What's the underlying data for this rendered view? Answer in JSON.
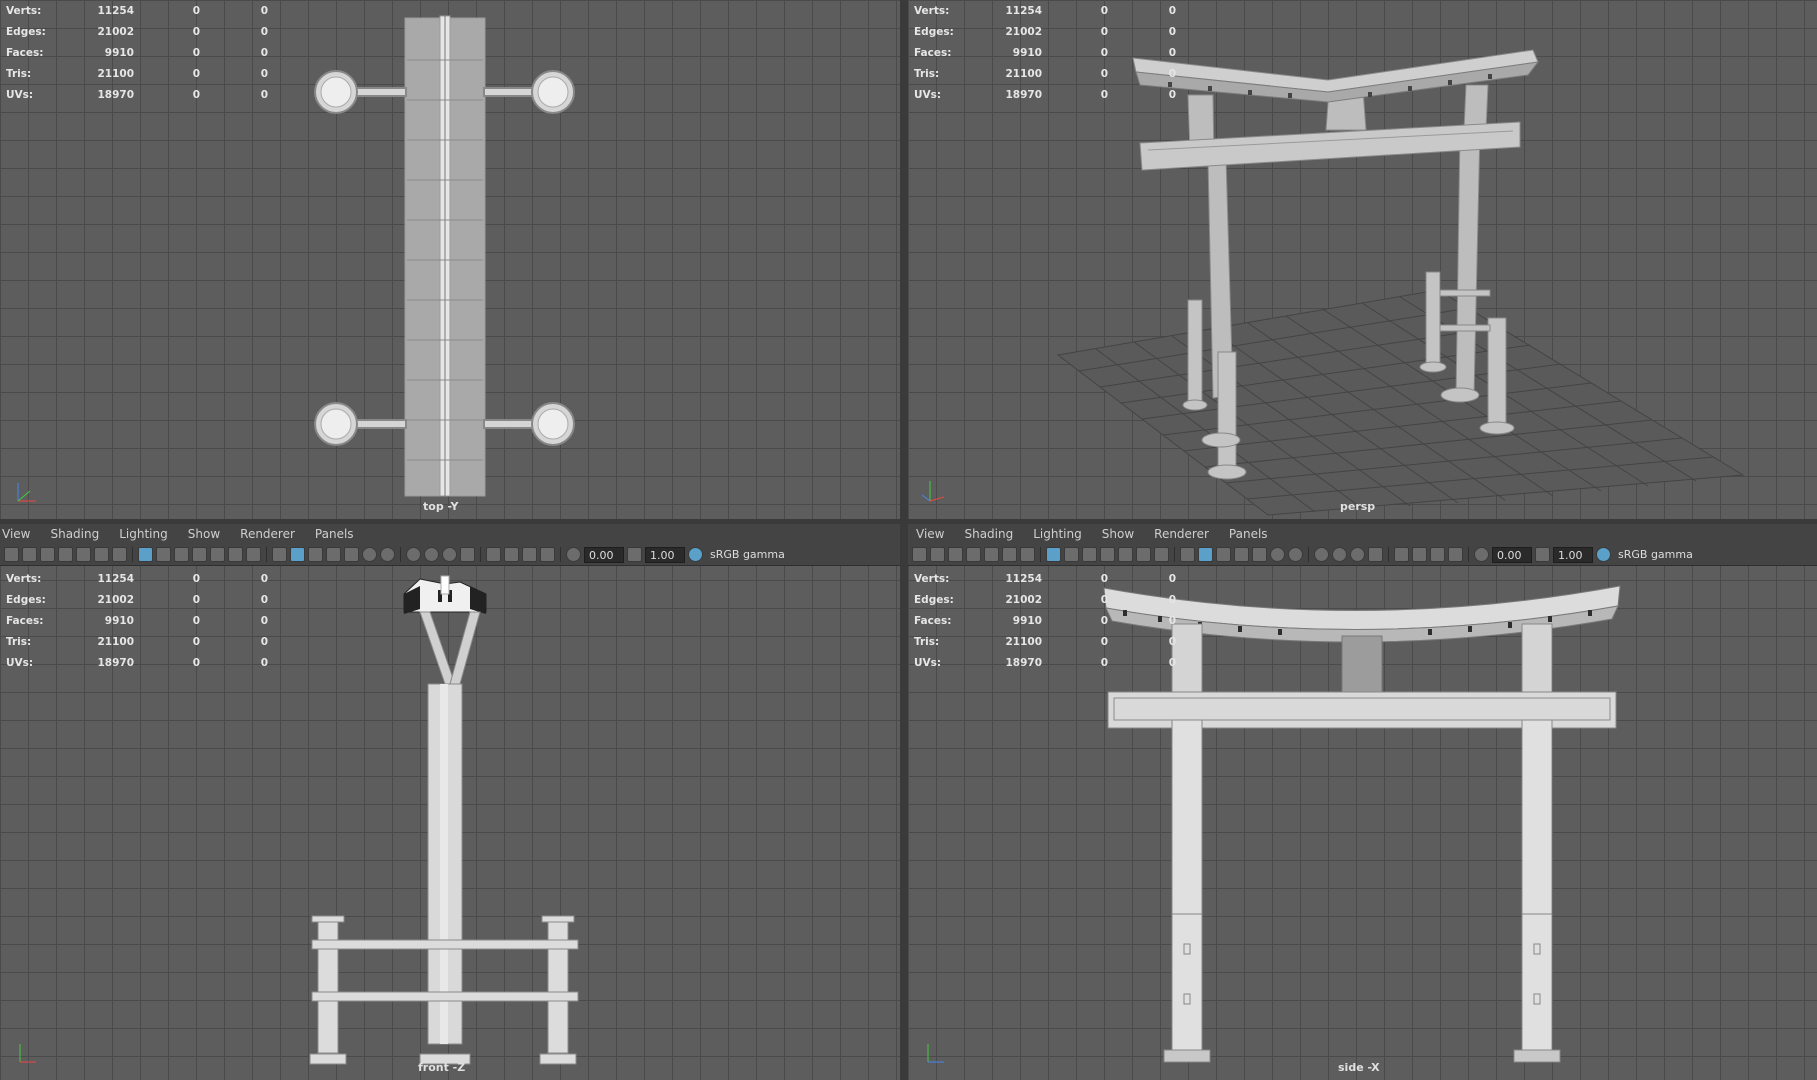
{
  "hud": {
    "rows": [
      {
        "label": "Verts:",
        "v1": "11254",
        "v2": "0",
        "v3": "0"
      },
      {
        "label": "Edges:",
        "v1": "21002",
        "v2": "0",
        "v3": "0"
      },
      {
        "label": "Faces:",
        "v1": "9910",
        "v2": "0",
        "v3": "0"
      },
      {
        "label": "Tris:",
        "v1": "21100",
        "v2": "0",
        "v3": "0"
      },
      {
        "label": "UVs:",
        "v1": "18970",
        "v2": "0",
        "v3": "0"
      }
    ]
  },
  "menu": {
    "view": "View",
    "shading": "Shading",
    "lighting": "Lighting",
    "show": "Show",
    "renderer": "Renderer",
    "panels": "Panels"
  },
  "toolbar": {
    "exposure": "0.00",
    "gamma_value": "1.00",
    "color_space": "sRGB gamma"
  },
  "cameras": {
    "top": "top -Y",
    "persp": "persp",
    "front": "front -Z",
    "side": "side -X"
  },
  "icons": {
    "camera": "camera-icon",
    "grid": "grid-toggle-icon",
    "shaded": "shaded-cube-icon",
    "light": "light-bulb-icon",
    "exposure": "exposure-icon",
    "gamma": "gamma-icon",
    "colorspace": "color-management-icon",
    "axis": "axis-gizmo-icon"
  },
  "colors": {
    "viewport_bg": "#5d5d5d",
    "panel_bg": "#444444",
    "active_button": "#5aa0c8",
    "model_gray": "#c8c8c8"
  }
}
